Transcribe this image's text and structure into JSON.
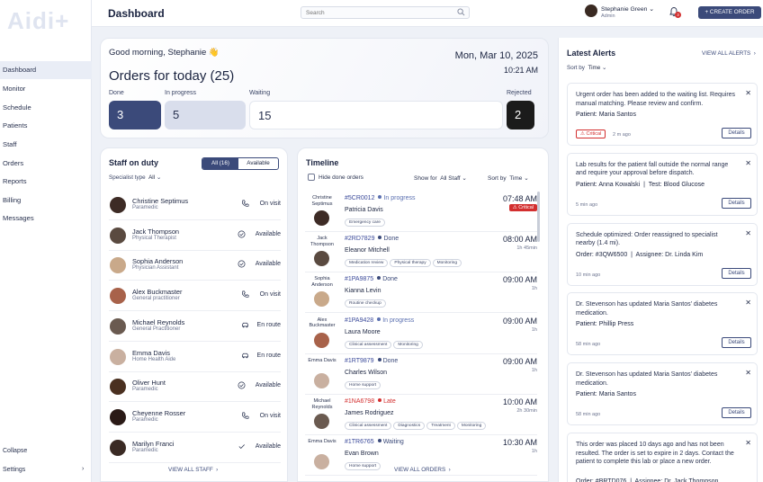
{
  "brand": {
    "logo_text": "Aidi+"
  },
  "sidebar": {
    "items": [
      {
        "label": "Dashboard"
      },
      {
        "label": "Monitor"
      },
      {
        "label": "Schedule"
      },
      {
        "label": "Patients"
      },
      {
        "label": "Staff"
      },
      {
        "label": "Orders"
      },
      {
        "label": "Reports"
      },
      {
        "label": "Billing"
      },
      {
        "label": "Messages"
      }
    ],
    "collapse_label": "Collapse",
    "settings_label": "Settings",
    "settings_chevron": "›"
  },
  "header": {
    "title": "Dashboard",
    "search_placeholder": "Search",
    "user_name": "Stephanie Green",
    "user_chevron": "⌄",
    "user_role": "Admin",
    "notification_count": "3",
    "create_order_label": "+ CREATE ORDER"
  },
  "orders": {
    "greeting": "Good morning, Stephanie 👋",
    "title": "Orders for today (25)",
    "date": "Mon, Mar 10, 2025",
    "time": "10:21 AM",
    "stats": [
      {
        "label": "Done",
        "value": "3",
        "color": "#3b4a7a"
      },
      {
        "label": "In progress",
        "value": "5",
        "color": "#d9deec"
      },
      {
        "label": "Waiting",
        "value": "15",
        "color": "#ffffff"
      },
      {
        "label": "Rejected",
        "value": "2",
        "color": "#1b1b1b"
      }
    ]
  },
  "staff": {
    "title": "Staff on duty",
    "toggle_all": "All (16)",
    "toggle_available": "Available",
    "filter_label": "Specialist type",
    "filter_value": "All",
    "view_all": "VIEW ALL STAFF",
    "members": [
      {
        "name": "Christine Septimus",
        "role": "Paramedic",
        "status": "On visit",
        "icon": "phone-icon",
        "avatar_color": "#3d2b25"
      },
      {
        "name": "Jack Thompson",
        "role": "Physical Therapist",
        "status": "Available",
        "icon": "check-circle-icon",
        "avatar_color": "#5a4a40"
      },
      {
        "name": "Sophia Anderson",
        "role": "Physician Assistant",
        "status": "Available",
        "icon": "check-circle-icon",
        "avatar_color": "#c9a98a"
      },
      {
        "name": "Alex Buckmaster",
        "role": "General practitioner",
        "status": "On visit",
        "icon": "phone-icon",
        "avatar_color": "#a8624a"
      },
      {
        "name": "Michael Reynolds",
        "role": "General Practitioner",
        "status": "En route",
        "icon": "car-icon",
        "avatar_color": "#6a5a50"
      },
      {
        "name": "Emma Davis",
        "role": "Home Health Aide",
        "status": "En route",
        "icon": "car-icon",
        "avatar_color": "#c9b0a0"
      },
      {
        "name": "Oliver Hunt",
        "role": "Paramedic",
        "status": "Available",
        "icon": "check-circle-icon",
        "avatar_color": "#4a3020"
      },
      {
        "name": "Cheyenne Rosser",
        "role": "Paramedic",
        "status": "On visit",
        "icon": "phone-icon",
        "avatar_color": "#2a1a16"
      },
      {
        "name": "Marilyn Franci",
        "role": "Paramedic",
        "status": "Available",
        "icon": "check-icon",
        "avatar_color": "#3a2a24"
      }
    ]
  },
  "timeline": {
    "title": "Timeline",
    "hide_done_label": "Hide done orders",
    "show_for_label": "Show for",
    "show_for_value": "All Staff",
    "sort_label": "Sort by",
    "sort_value": "Time",
    "view_all": "VIEW ALL ORDERS",
    "orders": [
      {
        "staff": "Christine Septimus",
        "order": "#5CR0012",
        "status": "In progress",
        "status_color": "#5a6fb0",
        "order_color": "#3b4a9a",
        "patient": "Patricia Davis",
        "tags": [
          "Emergency care"
        ],
        "time": "07:48 AM",
        "duration": "",
        "critical": "Critical",
        "avatar_color": "#3d2b25"
      },
      {
        "staff": "Jack Thompson",
        "order": "#2RD7829",
        "status": "Done",
        "status_color": "#3b4a7a",
        "order_color": "#3b4a9a",
        "patient": "Eleanor Mitchell",
        "tags": [
          "Medication review",
          "Physical therapy",
          "Monitoring"
        ],
        "time": "08:00 AM",
        "duration": "1h 45min",
        "critical": "",
        "avatar_color": "#5a4a40"
      },
      {
        "staff": "Sophia Anderson",
        "order": "#1PA9875",
        "status": "Done",
        "status_color": "#3b4a7a",
        "order_color": "#3b4a9a",
        "patient": "Kianna Levin",
        "tags": [
          "Routine checkup"
        ],
        "time": "09:00 AM",
        "duration": "1h",
        "critical": "",
        "avatar_color": "#c9a98a"
      },
      {
        "staff": "Alex Buckmaster",
        "order": "#1PA9428",
        "status": "In progress",
        "status_color": "#5a6fb0",
        "order_color": "#3b4a9a",
        "patient": "Laura Moore",
        "tags": [
          "Clinical assessment",
          "Monitoring"
        ],
        "time": "09:00 AM",
        "duration": "1h",
        "critical": "",
        "avatar_color": "#a8624a"
      },
      {
        "staff": "Emma Davis",
        "order": "#1RT9879",
        "status": "Done",
        "status_color": "#3b4a7a",
        "order_color": "#3b4a9a",
        "patient": "Charles Wilson",
        "tags": [
          "Home support"
        ],
        "time": "09:00 AM",
        "duration": "1h",
        "critical": "",
        "avatar_color": "#c9b0a0"
      },
      {
        "staff": "Michael Reynolds",
        "order": "#1NA6798",
        "status": "Late",
        "status_color": "#d32f2f",
        "order_color": "#d32f2f",
        "patient": "James Rodriguez",
        "tags": [
          "Clinical assessment",
          "Diagnostics",
          "Treatment",
          "Monitoring"
        ],
        "time": "10:00 AM",
        "duration": "2h 30min",
        "critical": "",
        "avatar_color": "#6a5a50"
      },
      {
        "staff": "Emma Davis",
        "order": "#1TR6765",
        "status": "Waiting",
        "status_color": "#3b4a7a",
        "order_color": "#3b4a9a",
        "patient": "Evan Brown",
        "tags": [
          "Home support"
        ],
        "time": "10:30 AM",
        "duration": "1h",
        "critical": "",
        "avatar_color": "#c9b0a0"
      }
    ]
  },
  "alerts": {
    "title": "Latest Alerts",
    "view_all": "VIEW ALL ALERTS",
    "sort_label": "Sort by",
    "sort_value": "Time",
    "details_label": "Details",
    "items": [
      {
        "text": "Urgent order has been added to the waiting list. Requires manual matching. Please review and confirm.",
        "meta1_label": "Patient:",
        "meta1_value": "Maria Santos",
        "meta2_label": "",
        "meta2_value": "",
        "badge": "Critical",
        "time": "2 m ago"
      },
      {
        "text": "Lab results for the patient fall outside the normal range and require your approval before dispatch.",
        "meta1_label": "Patient:",
        "meta1_value": "Anna Kowalski",
        "meta2_label": "Test:",
        "meta2_value": "Blood Glucose",
        "badge": "",
        "time": "5 min ago"
      },
      {
        "text": "Schedule optimized: Order reassigned to specialist nearby (1.4 mi).",
        "meta1_label": "Order:",
        "meta1_value": "#3QW6500",
        "meta2_label": "Assignee:",
        "meta2_value": "Dr. Linda Kim",
        "badge": "",
        "time": "10 min ago"
      },
      {
        "text": "Dr. Stevenson has updated Maria Santos' diabetes medication.",
        "meta1_label": "Patient:",
        "meta1_value": "Phillip Press",
        "meta2_label": "",
        "meta2_value": "",
        "badge": "",
        "time": "58 min ago"
      },
      {
        "text": "Dr. Stevenson has updated Maria Santos' diabetes medication.",
        "meta1_label": "Patient:",
        "meta1_value": "Maria Santos",
        "meta2_label": "",
        "meta2_value": "",
        "badge": "",
        "time": "58 min ago"
      },
      {
        "text": "This order was placed 10 days ago and has not been resulted. The order is set to expire in 2 days. Contact the patient to complete this lab or place a new order.",
        "meta1_label": "Order:",
        "meta1_value": "#BRTD076",
        "meta2_label": "Assignee:",
        "meta2_value": "Dr. Jack Thompson",
        "badge": "",
        "time": ""
      }
    ]
  }
}
